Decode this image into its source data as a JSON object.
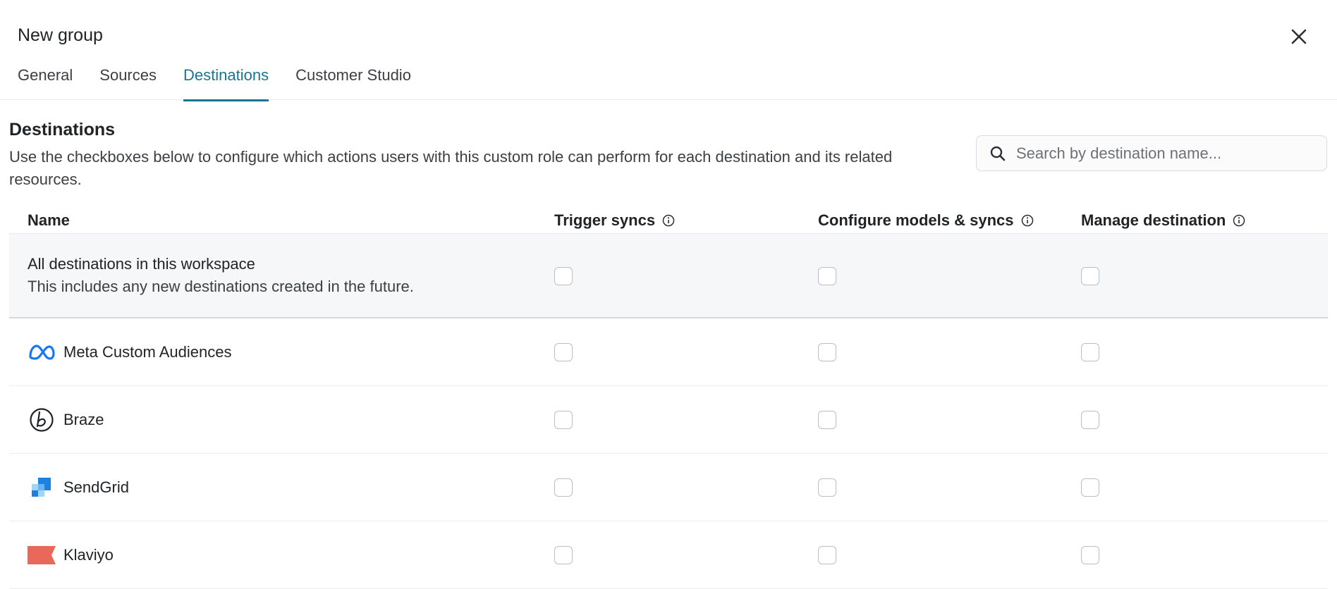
{
  "dialog": {
    "title": "New group"
  },
  "tabs": [
    {
      "label": "General",
      "active": false
    },
    {
      "label": "Sources",
      "active": false
    },
    {
      "label": "Destinations",
      "active": true
    },
    {
      "label": "Customer Studio",
      "active": false
    }
  ],
  "section": {
    "title": "Destinations",
    "description": "Use the checkboxes below to configure which actions users with this custom role can perform for each destination and its related resources."
  },
  "search": {
    "placeholder": "Search by destination name...",
    "value": ""
  },
  "table": {
    "columns": [
      "Name",
      "Trigger syncs",
      "Configure models & syncs",
      "Manage destination"
    ],
    "all_row": {
      "title": "All destinations in this workspace",
      "subtitle": "This includes any new destinations created in the future."
    },
    "destinations": [
      {
        "name": "Meta Custom Audiences",
        "icon": "meta-logo-icon"
      },
      {
        "name": "Braze",
        "icon": "braze-logo-icon"
      },
      {
        "name": "SendGrid",
        "icon": "sendgrid-logo-icon"
      },
      {
        "name": "Klaviyo",
        "icon": "klaviyo-logo-icon"
      }
    ]
  },
  "colors": {
    "accent": "#1a7590",
    "meta": "#1877f2",
    "sendgrid": "#1a82e2",
    "klaviyo": "#e8685a"
  }
}
